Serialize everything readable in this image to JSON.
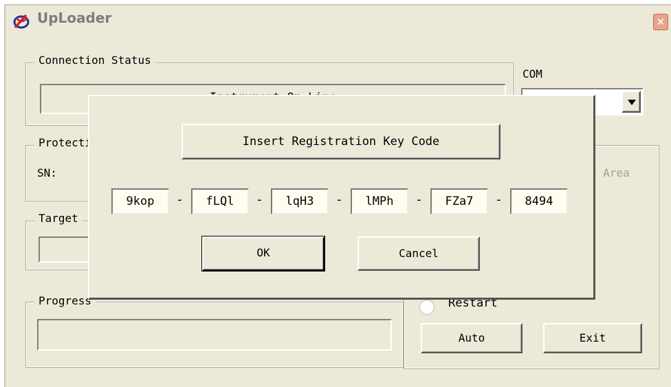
{
  "window": {
    "title": "UpLoader",
    "close_glyph": "✕"
  },
  "connection": {
    "legend": "Connection Status",
    "status_text": "Instrument On Line"
  },
  "com": {
    "label": "COM",
    "value": ""
  },
  "protection": {
    "legend": "Protection",
    "sn_label": "SN:",
    "right_text": "t Area"
  },
  "target": {
    "legend": "Target"
  },
  "progress": {
    "legend": "Progress"
  },
  "restart": {
    "label": "Restart"
  },
  "buttons": {
    "auto": "Auto",
    "exit": "Exit"
  },
  "dialog": {
    "title_button": "Insert Registration Key Code",
    "key_parts": [
      "9kop",
      "fLQl",
      "lqH3",
      "lMPh",
      "FZa7",
      "8494"
    ],
    "separator": "-",
    "ok": "OK",
    "cancel": "Cancel"
  },
  "colors": {
    "face": "#ece9d8",
    "field": "#fffdf0",
    "close": "#e6a58f"
  }
}
